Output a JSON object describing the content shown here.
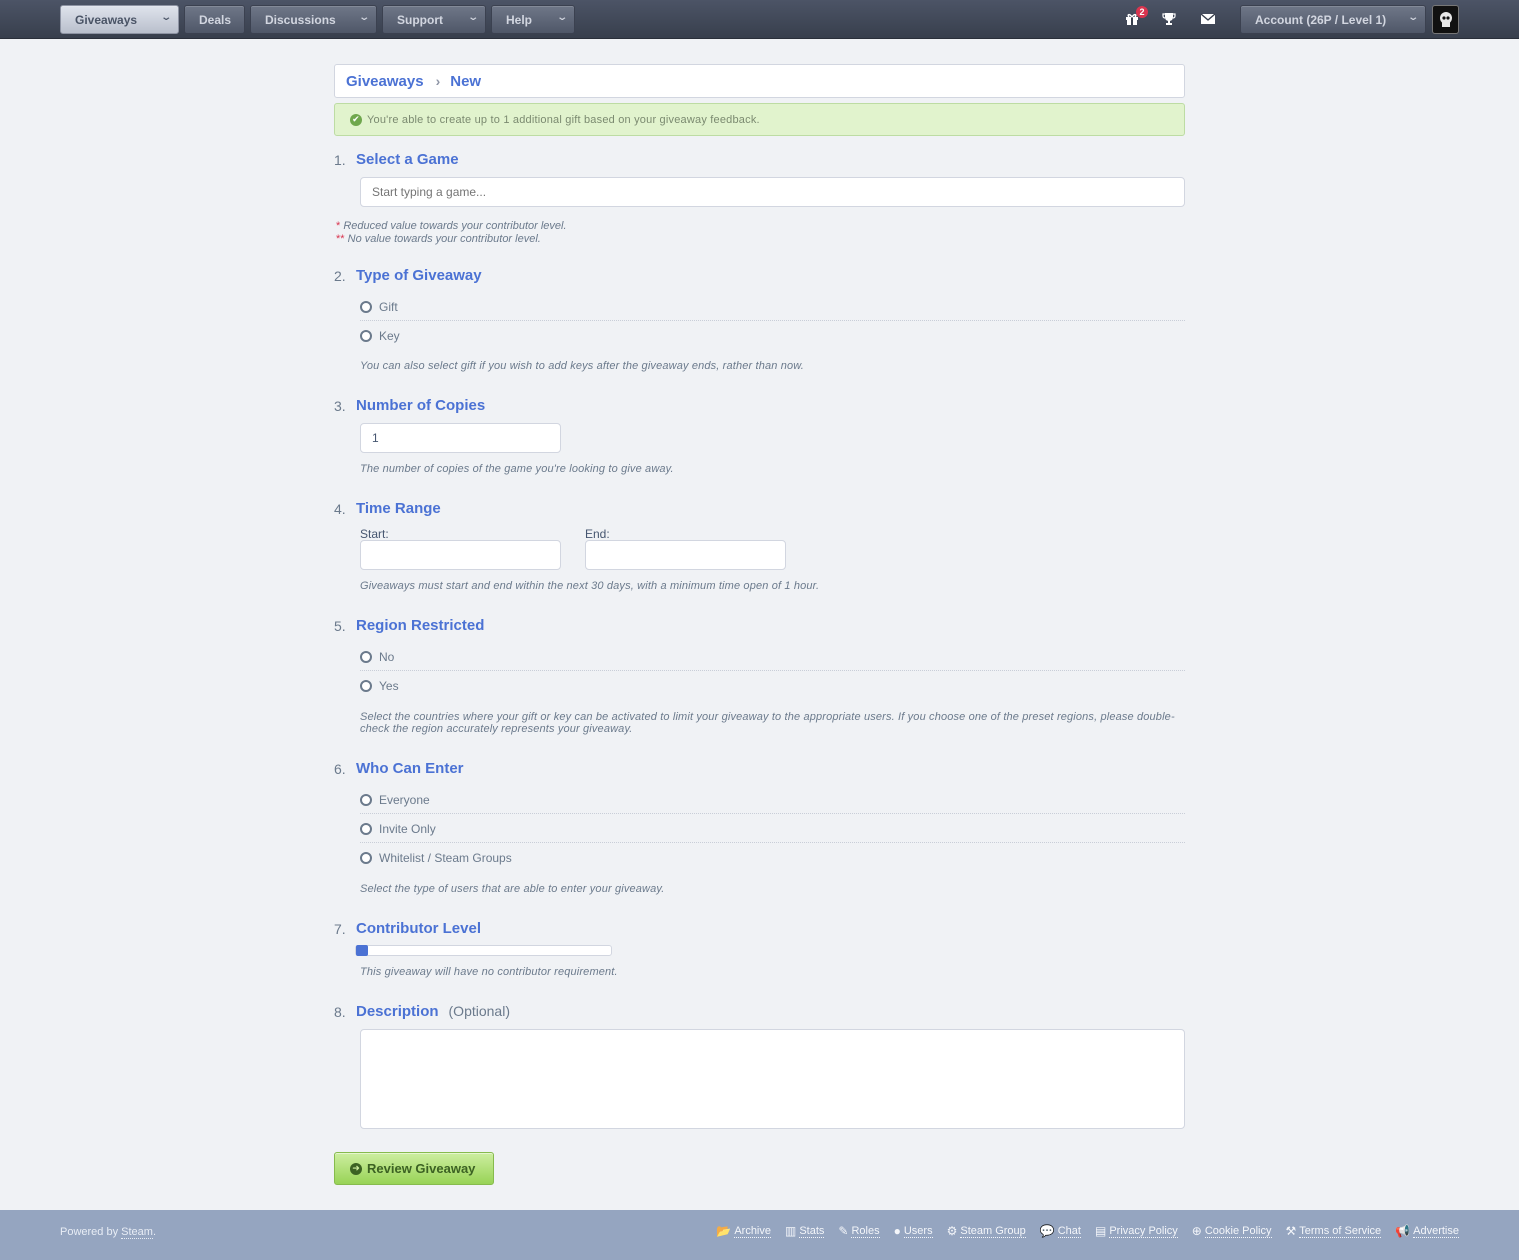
{
  "nav": {
    "items": [
      {
        "label": "Giveaways"
      },
      {
        "label": "Deals"
      },
      {
        "label": "Discussions"
      },
      {
        "label": "Support"
      },
      {
        "label": "Help"
      }
    ],
    "gift_badge": "2",
    "account_label": "Account (26P / Level 1)"
  },
  "breadcrumb": {
    "root": "Giveaways",
    "current": "New"
  },
  "notice": "You're able to create up to 1 additional gift based on your giveaway feedback.",
  "sections": {
    "s1": {
      "num": "1.",
      "title": "Select a Game",
      "placeholder": "Start typing a game...",
      "note1_star": "*",
      "note1": "Reduced value towards your contributor level.",
      "note2_star": "**",
      "note2": "No value towards your contributor level."
    },
    "s2": {
      "num": "2.",
      "title": "Type of Giveaway",
      "options": [
        "Gift",
        "Key"
      ],
      "hint": "You can also select gift if you wish to add keys after the giveaway ends, rather than now."
    },
    "s3": {
      "num": "3.",
      "title": "Number of Copies",
      "value": "1",
      "hint": "The number of copies of the game you're looking to give away."
    },
    "s4": {
      "num": "4.",
      "title": "Time Range",
      "start_label": "Start:",
      "end_label": "End:",
      "hint": "Giveaways must start and end within the next 30 days, with a minimum time open of 1 hour."
    },
    "s5": {
      "num": "5.",
      "title": "Region Restricted",
      "options": [
        "No",
        "Yes"
      ],
      "hint": "Select the countries where your gift or key can be activated to limit your giveaway to the appropriate users. If you choose one of the preset regions, please double-check the region accurately represents your giveaway."
    },
    "s6": {
      "num": "6.",
      "title": "Who Can Enter",
      "options": [
        "Everyone",
        "Invite Only",
        "Whitelist / Steam Groups"
      ],
      "hint": "Select the type of users that are able to enter your giveaway."
    },
    "s7": {
      "num": "7.",
      "title": "Contributor Level",
      "slider_value": 0,
      "hint": "This giveaway will have no contributor requirement."
    },
    "s8": {
      "num": "8.",
      "title": "Description",
      "optional": "(Optional)"
    }
  },
  "review_button": "Review Giveaway",
  "footer": {
    "powered_prefix": "Powered by",
    "powered_link": "Steam",
    "powered_suffix": ".",
    "links": [
      "Archive",
      "Stats",
      "Roles",
      "Users",
      "Steam Group",
      "Chat",
      "Privacy Policy",
      "Cookie Policy",
      "Terms of Service",
      "Advertise"
    ]
  }
}
